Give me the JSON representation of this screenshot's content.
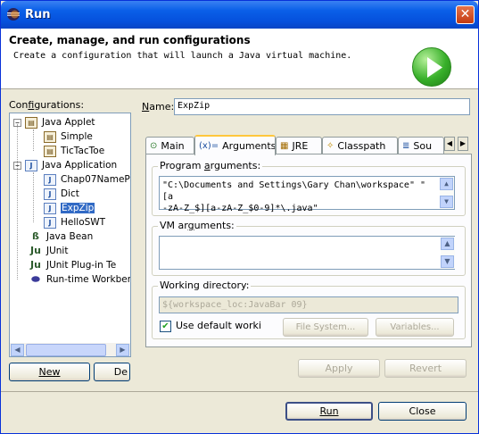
{
  "window": {
    "title": "Run",
    "close_glyph": "✕"
  },
  "banner": {
    "title": "Create, manage, and run configurations",
    "description": "Create a configuration that will launch a Java virtual machine.",
    "icon": "run-icon"
  },
  "configurations": {
    "label": "Configurations:",
    "tree": [
      {
        "label": "Java Applet",
        "level": 0,
        "expanded": true,
        "icon": "applet-icon"
      },
      {
        "label": "Simple",
        "level": 1,
        "icon": "applet-icon"
      },
      {
        "label": "TicTacToe",
        "level": 1,
        "icon": "applet-icon"
      },
      {
        "label": "Java Application",
        "level": 0,
        "expanded": true,
        "icon": "java-app-icon"
      },
      {
        "label": "Chap07NamePar",
        "level": 1,
        "icon": "java-app-icon"
      },
      {
        "label": "Dict",
        "level": 1,
        "icon": "java-app-icon"
      },
      {
        "label": "ExpZip",
        "level": 1,
        "icon": "java-app-icon",
        "selected": true
      },
      {
        "label": "HelloSWT",
        "level": 1,
        "icon": "java-app-icon"
      },
      {
        "label": "Java Bean",
        "level": 0,
        "icon": "java-bean-icon"
      },
      {
        "label": "JUnit",
        "level": 0,
        "icon": "junit-icon"
      },
      {
        "label": "JUnit Plug-in Te",
        "level": 0,
        "icon": "junit-plugin-icon"
      },
      {
        "label": "Run-time Workber",
        "level": 0,
        "icon": "workbench-icon"
      }
    ],
    "new_button": "New",
    "delete_button": "De"
  },
  "name_field": {
    "label": "Name:",
    "value": "ExpZip"
  },
  "tabs": [
    {
      "label": "Main",
      "icon": "main-tab-icon",
      "glyph": "⊙"
    },
    {
      "label": "Arguments",
      "icon": "arguments-tab-icon",
      "glyph": "(x)=",
      "active": true
    },
    {
      "label": "JRE",
      "icon": "jre-tab-icon",
      "glyph": "▦"
    },
    {
      "label": "Classpath",
      "icon": "classpath-tab-icon",
      "glyph": "✧"
    },
    {
      "label": "Sou",
      "icon": "source-tab-icon",
      "glyph": "≣"
    }
  ],
  "arguments": {
    "program_label": "Program arguments:",
    "program_value_line1": "\"C:\\Documents and Settings\\Gary Chan\\workspace\" \"[a",
    "program_value_line2": "-zA-Z_$][a-zA-Z_$0-9]*\\.java\"",
    "vm_label": "VM arguments:",
    "vm_value": "",
    "working_dir_label": "Working directory:",
    "working_dir_value": "${workspace_loc:JavaBar 09}",
    "use_default_label": "Use default worki",
    "use_default_checked": true,
    "file_system_button": "File System...",
    "variables_button": "Variables..."
  },
  "actions": {
    "apply": "Apply",
    "revert": "Revert",
    "run": "Run",
    "close": "Close"
  }
}
